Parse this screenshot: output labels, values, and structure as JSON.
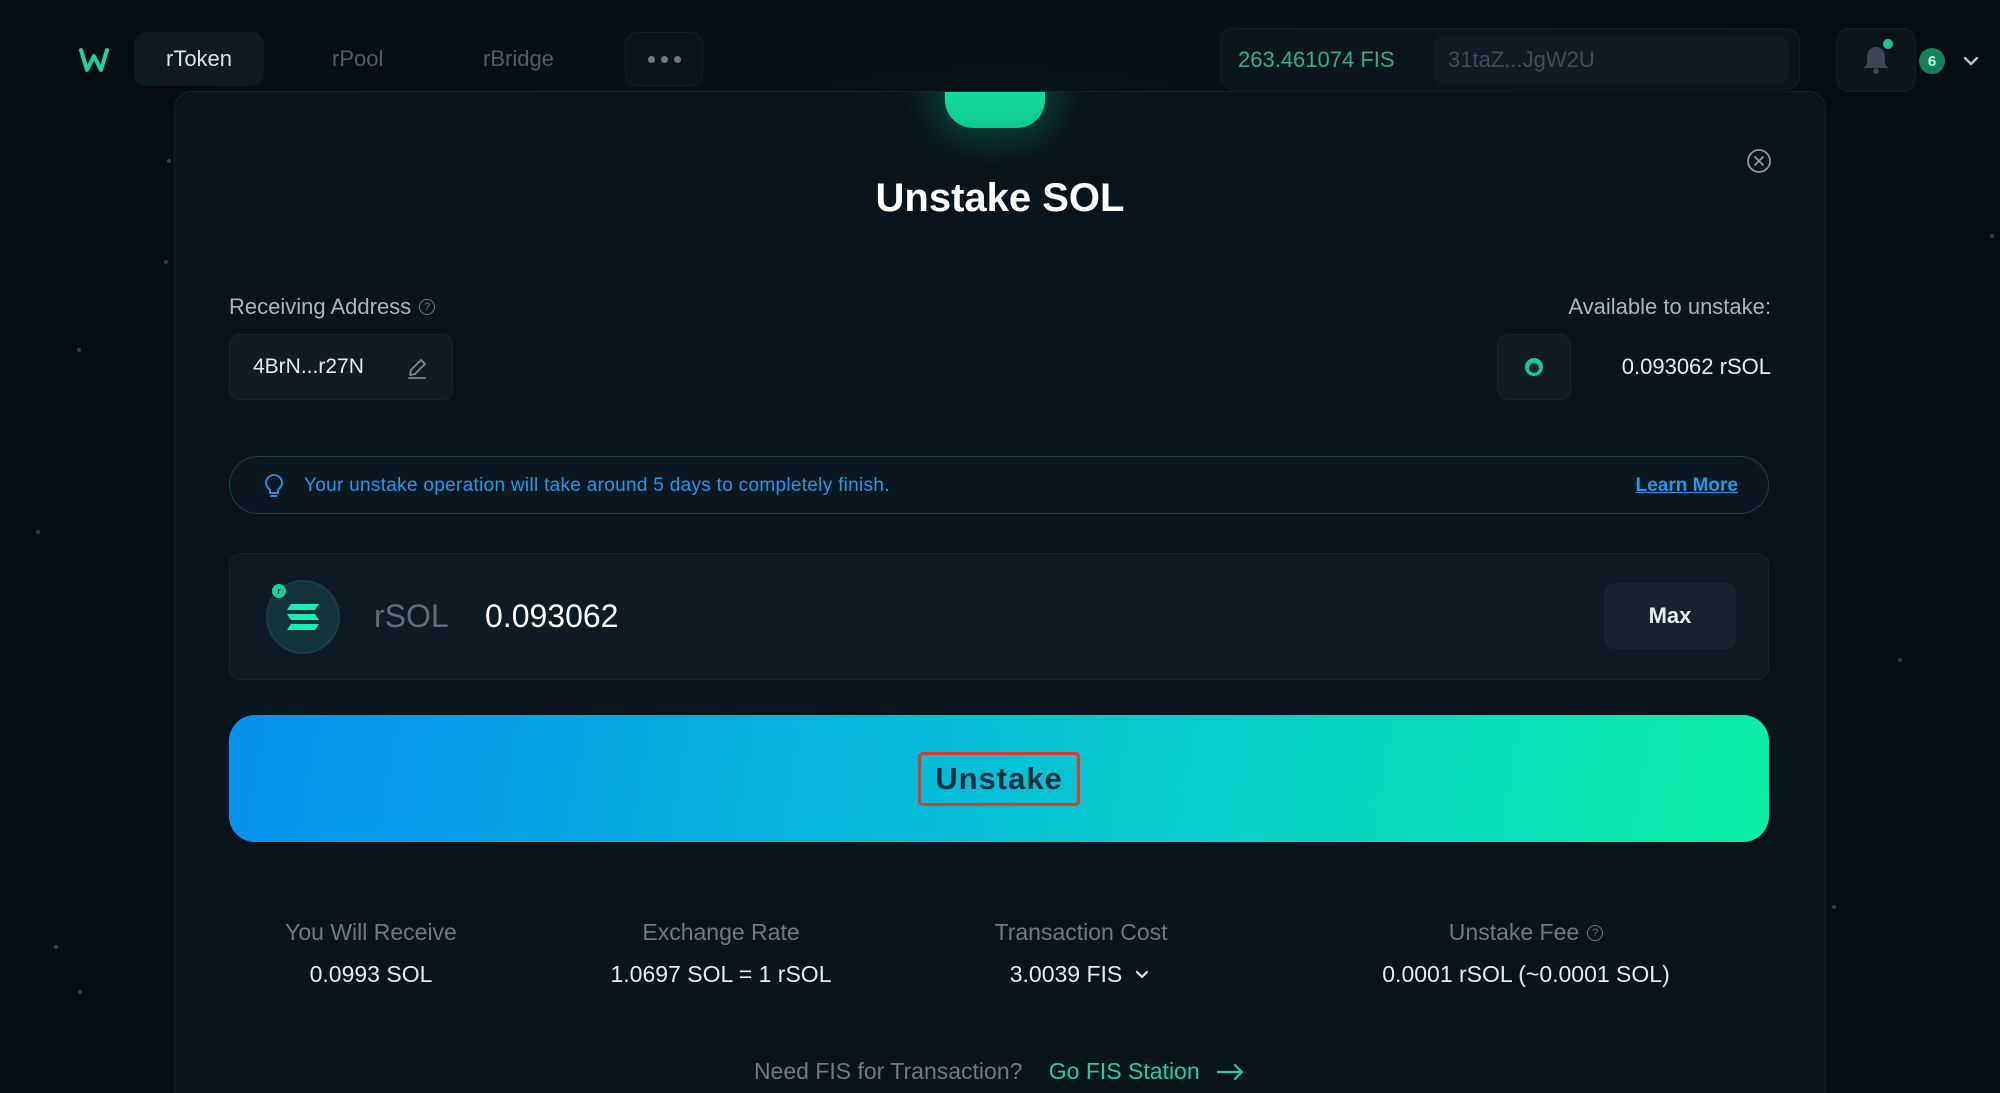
{
  "colors": {
    "accent": "#1fd19a",
    "info": "#1e9ae6",
    "highlight_box": "#e03a2a"
  },
  "nav": {
    "tabs": [
      {
        "label": "rToken",
        "active": true
      },
      {
        "label": "rPool",
        "active": false
      },
      {
        "label": "rBridge",
        "active": false
      }
    ],
    "more_icon": "more-horizontal-icon",
    "balance": "263.461074 FIS",
    "wallet_address": "31taZ...JgW2U",
    "wallet_coin_icon": "polkadot-icon",
    "notification_count": "6",
    "bell_icon": "bell-icon"
  },
  "modal": {
    "title": "Unstake SOL",
    "receiving_address_label": "Receiving Address",
    "receiving_address": "4BrN...r27N",
    "available_label": "Available to unstake:",
    "available_value": "0.093062 rSOL",
    "notice_text": "Your unstake operation will take around 5 days to completely finish.",
    "learn_more": "Learn More",
    "token_name": "rSOL",
    "amount": "0.093062",
    "max_label": "Max",
    "unstake_label": "Unstake",
    "stats": [
      {
        "label": "You Will Receive",
        "value": "0.0993 SOL"
      },
      {
        "label": "Exchange Rate",
        "value": "1.0697 SOL = 1 rSOL"
      },
      {
        "label": "Transaction Cost",
        "value": "3.0039 FIS"
      },
      {
        "label": "Unstake Fee",
        "value": "0.0001 rSOL (~0.0001 SOL)"
      }
    ],
    "need_fis_text": "Need FIS for Transaction?",
    "go_station_link": "Go FIS Station"
  }
}
